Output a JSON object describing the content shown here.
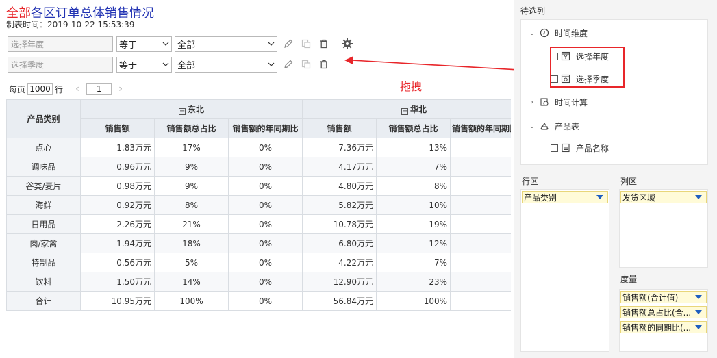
{
  "header": {
    "title_prefix": "全部",
    "title_main": "各区订单总体销售情况",
    "subtitle": "制表时间：2019-10-22 15:53:39"
  },
  "filters": [
    {
      "placeholder": "选择年度",
      "operator": "等于",
      "value": "全部"
    },
    {
      "placeholder": "选择季度",
      "operator": "等于",
      "value": "全部"
    }
  ],
  "pager": {
    "per_page_label": "每页",
    "per_page": "1000",
    "unit": "行",
    "page": "1"
  },
  "annotation": {
    "drag_label": "拖拽",
    "color": "#e8262a"
  },
  "table": {
    "row_header": "产品类别",
    "regions": [
      "东北",
      "华北"
    ],
    "measures": [
      "销售额",
      "销售额总占比",
      "销售额的年同期比"
    ],
    "rows": [
      {
        "label": "点心",
        "ne": [
          "1.83万元",
          "17%",
          "0%"
        ],
        "nc": [
          "7.36万元",
          "13%",
          ""
        ]
      },
      {
        "label": "调味品",
        "ne": [
          "0.96万元",
          "9%",
          "0%"
        ],
        "nc": [
          "4.17万元",
          "7%",
          ""
        ]
      },
      {
        "label": "谷类/麦片",
        "ne": [
          "0.98万元",
          "9%",
          "0%"
        ],
        "nc": [
          "4.80万元",
          "8%",
          ""
        ]
      },
      {
        "label": "海鲜",
        "ne": [
          "0.92万元",
          "8%",
          "0%"
        ],
        "nc": [
          "5.82万元",
          "10%",
          ""
        ]
      },
      {
        "label": "日用品",
        "ne": [
          "2.26万元",
          "21%",
          "0%"
        ],
        "nc": [
          "10.78万元",
          "19%",
          ""
        ]
      },
      {
        "label": "肉/家禽",
        "ne": [
          "1.94万元",
          "18%",
          "0%"
        ],
        "nc": [
          "6.80万元",
          "12%",
          ""
        ]
      },
      {
        "label": "特制品",
        "ne": [
          "0.56万元",
          "5%",
          "0%"
        ],
        "nc": [
          "4.22万元",
          "7%",
          ""
        ]
      },
      {
        "label": "饮料",
        "ne": [
          "1.50万元",
          "14%",
          "0%"
        ],
        "nc": [
          "12.90万元",
          "23%",
          ""
        ]
      },
      {
        "label": "合计",
        "ne": [
          "10.95万元",
          "100%",
          "0%"
        ],
        "nc": [
          "56.84万元",
          "100%",
          ""
        ]
      }
    ]
  },
  "panel": {
    "candidates_title": "待选列",
    "tree": {
      "time_dim": "时间维度",
      "select_year": "选择年度",
      "select_quarter": "选择季度",
      "time_calc": "时间计算",
      "product_table": "产品表",
      "product_name": "产品名称"
    },
    "row_zone": {
      "title": "行区",
      "chips": [
        "产品类别"
      ]
    },
    "col_zone": {
      "title": "列区",
      "chips": [
        "发货区域"
      ]
    },
    "measure_zone": {
      "title": "度量",
      "chips": [
        "销售额(合计值)",
        "销售额总占比(合...",
        "销售额的同期比(..."
      ]
    }
  },
  "colors": {
    "accent_blue": "#2233b3",
    "accent_red": "#e8262a",
    "chip_bg": "#fffbd8",
    "chip_caret": "#1f5fbf"
  }
}
